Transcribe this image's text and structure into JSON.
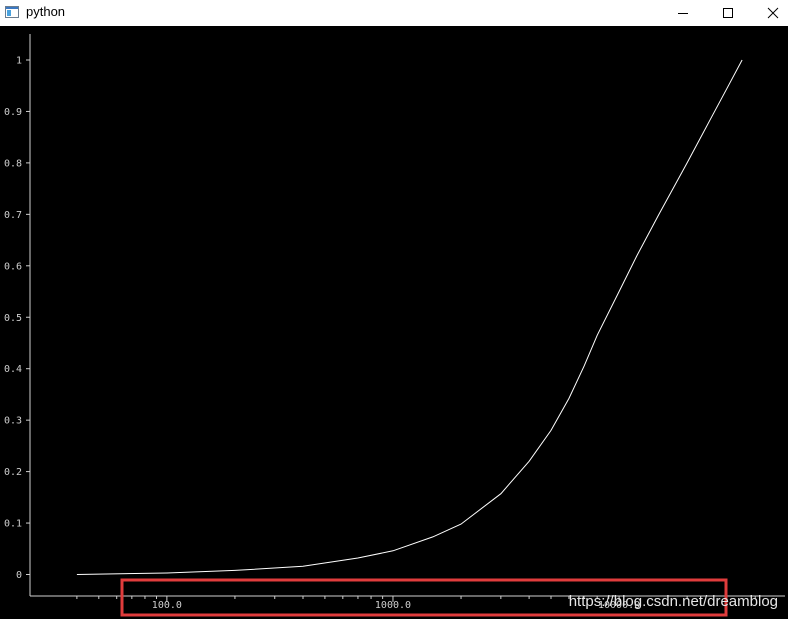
{
  "window": {
    "title": "python",
    "icon": "python-window-icon"
  },
  "controls": {
    "minimize": "minimize-icon",
    "maximize": "maximize-icon",
    "close": "close-icon"
  },
  "watermark": "https://blog.csdn.net/dreamblog",
  "highlight_color": "#e03c3c",
  "colors": {
    "background": "#000000",
    "axis": "#cfcfcf",
    "curve": "#ffffff"
  },
  "chart_data": {
    "type": "line",
    "title": "",
    "xlabel": "",
    "ylabel": "",
    "xscale": "log",
    "xlim": [
      33,
      42000
    ],
    "ylim": [
      -0.04,
      1.04
    ],
    "grid": false,
    "x_tick_labels": [
      "100.0",
      "1000.0",
      "10000.0"
    ],
    "y_tick_labels": [
      "0",
      "0.1",
      "0.2",
      "0.3",
      "0.4",
      "0.5",
      "0.6",
      "0.7",
      "0.8",
      "0.9",
      "1"
    ],
    "series": [
      {
        "x": [
          40,
          100,
          200,
          400,
          700,
          1000,
          1500,
          2000,
          3000,
          4000,
          5000,
          6000,
          7000,
          8000,
          10000,
          12000,
          15000,
          20000,
          25000,
          30000,
          35000
        ],
        "y": [
          0.0,
          0.003,
          0.008,
          0.016,
          0.032,
          0.046,
          0.073,
          0.098,
          0.157,
          0.22,
          0.28,
          0.342,
          0.405,
          0.465,
          0.55,
          0.62,
          0.7,
          0.8,
          0.88,
          0.945,
          1.0
        ]
      }
    ]
  }
}
